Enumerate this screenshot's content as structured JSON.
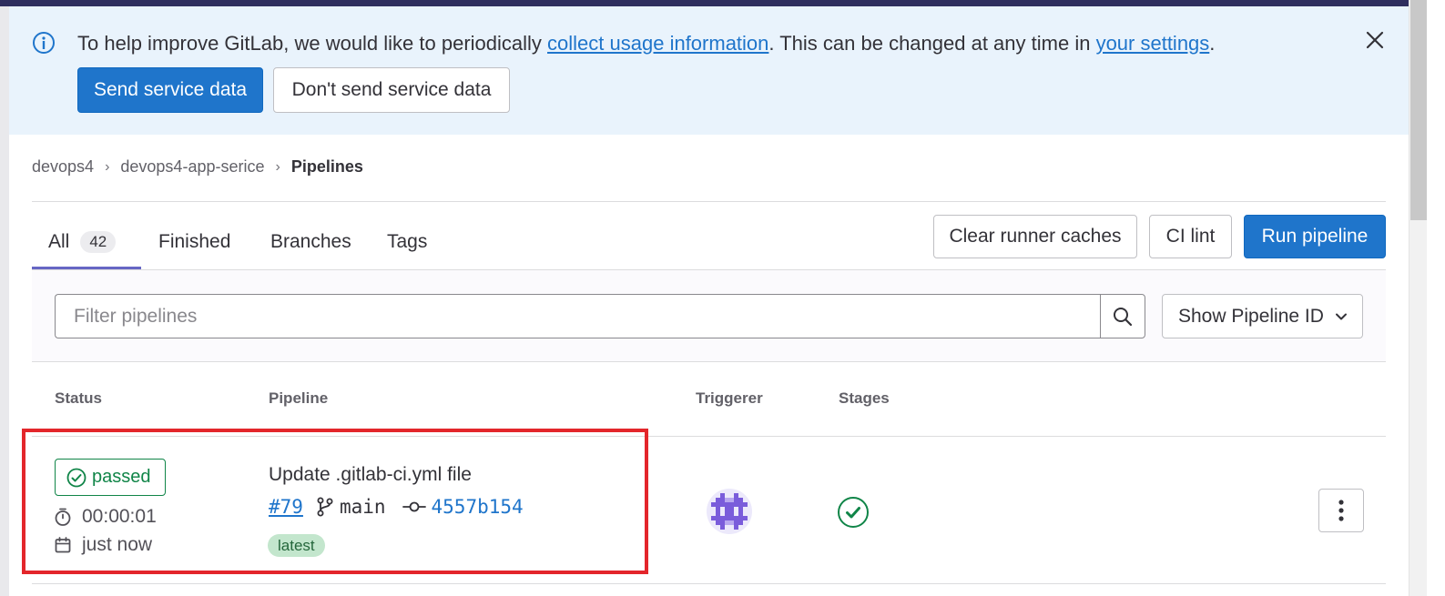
{
  "banner": {
    "text_before": "To help improve GitLab, we would like to periodically ",
    "link1": "collect usage information",
    "text_middle": ". This can be changed at any time in ",
    "link2": "your settings",
    "text_after": ".",
    "primary_button": "Send service data",
    "secondary_button": "Don't send service data"
  },
  "breadcrumb": {
    "items": [
      "devops4",
      "devops4-app-serice",
      "Pipelines"
    ]
  },
  "tabs": [
    {
      "label": "All",
      "count": "42",
      "active": true
    },
    {
      "label": "Finished"
    },
    {
      "label": "Branches"
    },
    {
      "label": "Tags"
    }
  ],
  "actions": {
    "clear_caches": "Clear runner caches",
    "ci_lint": "CI lint",
    "run_pipeline": "Run pipeline"
  },
  "filter": {
    "placeholder": "Filter pipelines",
    "show_id": "Show Pipeline ID"
  },
  "table": {
    "headers": [
      "Status",
      "Pipeline",
      "Triggerer",
      "Stages"
    ],
    "rows": [
      {
        "status": "passed",
        "duration": "00:00:01",
        "finished": "just now",
        "title": "Update .gitlab-ci.yml file",
        "pipeline_id": "#79",
        "branch": "main",
        "sha": "4557b154",
        "badge": "latest"
      }
    ]
  },
  "colors": {
    "primary": "#1f75cb",
    "success": "#108548",
    "highlight": "#e3262b",
    "tab_active": "#6666c4"
  }
}
